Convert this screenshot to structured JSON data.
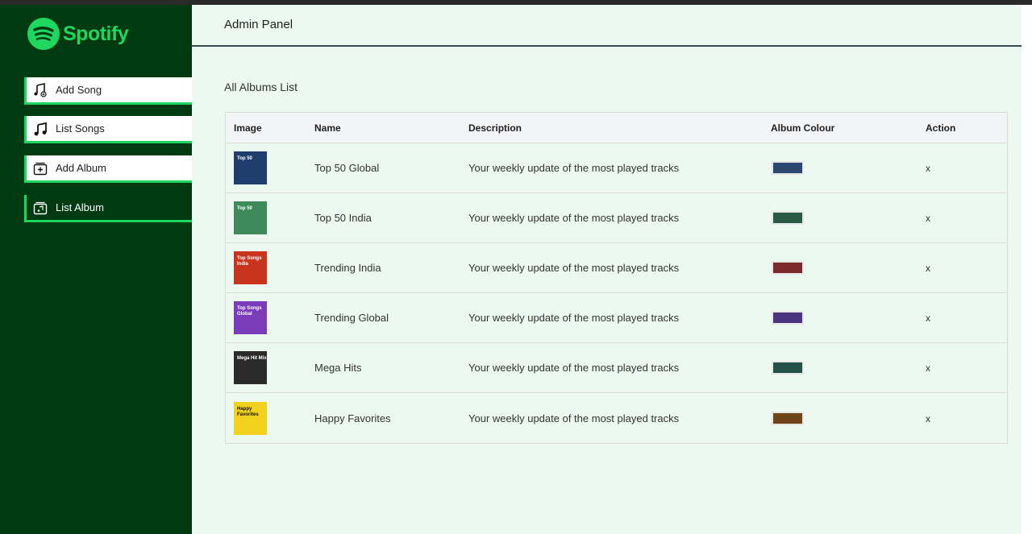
{
  "brand": {
    "name": "Spotify",
    "accent": "#1ed760",
    "sidebar_bg": "#003a10"
  },
  "sidebar": {
    "items": [
      {
        "label": "Add Song",
        "icon": "music-note-plus-icon"
      },
      {
        "label": "List Songs",
        "icon": "music-notes-icon"
      },
      {
        "label": "Add Album",
        "icon": "album-plus-icon"
      },
      {
        "label": "List Album",
        "icon": "album-list-icon",
        "active": true
      }
    ]
  },
  "header": {
    "title": "Admin Panel"
  },
  "main": {
    "section_title": "All Albums List",
    "columns": [
      "Image",
      "Name",
      "Description",
      "Album Colour",
      "Action"
    ],
    "rows": [
      {
        "name": "Top 50 Global",
        "description": "Your weekly update of the most played tracks",
        "colour": "#2b4770",
        "thumb_text": "Top 50",
        "thumb_bg": "#1f3d6e",
        "action": "x"
      },
      {
        "name": "Top 50 India",
        "description": "Your weekly update of the most played tracks",
        "colour": "#2a5a44",
        "thumb_text": "Top 50",
        "thumb_bg": "#3f8a5a",
        "action": "x"
      },
      {
        "name": "Trending India",
        "description": "Your weekly update of the most played tracks",
        "colour": "#7a2a2a",
        "thumb_text": "Top Songs India",
        "thumb_bg": "#c8341c",
        "action": "x"
      },
      {
        "name": "Trending Global",
        "description": "Your weekly update of the most played tracks",
        "colour": "#4a3480",
        "thumb_text": "Top Songs Global",
        "thumb_bg": "#7a3cb8",
        "action": "x"
      },
      {
        "name": "Mega Hits",
        "description": "Your weekly update of the most played tracks",
        "colour": "#24504a",
        "thumb_text": "Mega Hit Mix",
        "thumb_bg": "#2a2a2a",
        "action": "x"
      },
      {
        "name": "Happy Favorites",
        "description": "Your weekly update of the most played tracks",
        "colour": "#6e4418",
        "thumb_text": "Happy Favorites",
        "thumb_bg": "#f2d21c",
        "action": "x"
      }
    ]
  }
}
